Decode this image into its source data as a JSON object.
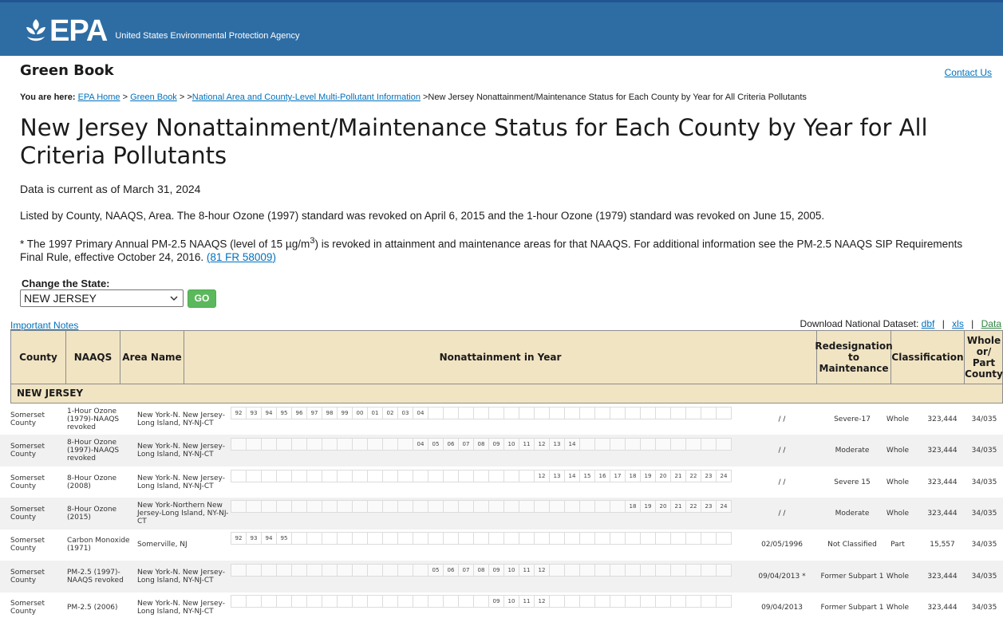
{
  "header": {
    "logo_text": "EPA",
    "agency_name": "United States Environmental Protection Agency"
  },
  "site_name": "Green Book",
  "contact_label": "Contact Us",
  "breadcrumb": {
    "prefix": "You are here:",
    "items": [
      "EPA Home",
      "Green Book",
      "National Area and County-Level Multi-Pollutant Information"
    ],
    "current": "New Jersey Nonattainment/Maintenance Status for Each County by Year for All Criteria Pollutants",
    "sep1": " > ",
    "sep2": " > >",
    "sep3": " >"
  },
  "page_title": "New Jersey Nonattainment/Maintenance Status for Each County by Year for All Criteria Pollutants",
  "as_of": "Data is current as of March 31, 2024",
  "listed_text": "Listed by County, NAAQS, Area. The 8-hour Ozone (1997) standard was revoked on April 6, 2015 and the 1-hour Ozone (1979) standard was revoked on June 15, 2005.",
  "note": {
    "text_a": "* The 1997 Primary Annual PM-2.5 NAAQS (level of 15 µg/m",
    "sup": "3",
    "text_b": ") is revoked in attainment and maintenance areas for that NAAQS. For additional information see the PM-2.5 NAAQS SIP Requirements Final Rule, effective October 24, 2016. ",
    "link": "(81 FR 58009)"
  },
  "state_selector": {
    "label": "Change the State:",
    "selected": "NEW JERSEY",
    "go_label": "GO"
  },
  "important_notes": "Important Notes",
  "download": {
    "label": "Download National Dataset:",
    "dbf": "dbf",
    "xls": "xls",
    "data": "Data",
    "sep": "|"
  },
  "table": {
    "headers": {
      "county": "County",
      "naaqs": "NAAQS",
      "area": "Area Name",
      "years": "Nonattainment in Year",
      "redesignation": "Redesignation to Maintenance",
      "classification": "Classification",
      "whole_part": "Whole or/ Part County"
    },
    "state_row": "NEW JERSEY",
    "rows": [
      {
        "county": "Somerset County",
        "naaqs": "1-Hour Ozone (1979)-NAAQS revoked",
        "area": "New York-N. New Jersey-Long Island, NY-NJ-CT",
        "years": [
          "92",
          "93",
          "94",
          "95",
          "96",
          "97",
          "98",
          "99",
          "00",
          "01",
          "02",
          "03",
          "04",
          "",
          "",
          "",
          "",
          "",
          "",
          "",
          "",
          "",
          "",
          "",
          "",
          "",
          "",
          "",
          "",
          "",
          "",
          "",
          ""
        ],
        "redesignation": "/ /",
        "classification": "Severe-17",
        "whole_part": "Whole",
        "population": "323,444",
        "fips": "34/035"
      },
      {
        "county": "Somerset County",
        "naaqs": "8-Hour Ozone (1997)-NAAQS revoked",
        "area": "New York-N. New Jersey-Long Island, NY-NJ-CT",
        "years": [
          "",
          "",
          "",
          "",
          "",
          "",
          "",
          "",
          "",
          "",
          "",
          "",
          "04",
          "05",
          "06",
          "07",
          "08",
          "09",
          "10",
          "11",
          "12",
          "13",
          "14",
          "",
          "",
          "",
          "",
          "",
          "",
          "",
          "",
          "",
          ""
        ],
        "redesignation": "/ /",
        "classification": "Moderate",
        "whole_part": "Whole",
        "population": "323,444",
        "fips": "34/035"
      },
      {
        "county": "Somerset County",
        "naaqs": "8-Hour Ozone (2008)",
        "area": "New York-N. New Jersey-Long Island, NY-NJ-CT",
        "years": [
          "",
          "",
          "",
          "",
          "",
          "",
          "",
          "",
          "",
          "",
          "",
          "",
          "",
          "",
          "",
          "",
          "",
          "",
          "",
          "",
          "12",
          "13",
          "14",
          "15",
          "16",
          "17",
          "18",
          "19",
          "20",
          "21",
          "22",
          "23",
          "24"
        ],
        "redesignation": "/ /",
        "classification": "Severe 15",
        "whole_part": "Whole",
        "population": "323,444",
        "fips": "34/035"
      },
      {
        "county": "Somerset County",
        "naaqs": "8-Hour Ozone (2015)",
        "area": "New York-Northern New Jersey-Long Island, NY-NJ-CT",
        "years": [
          "",
          "",
          "",
          "",
          "",
          "",
          "",
          "",
          "",
          "",
          "",
          "",
          "",
          "",
          "",
          "",
          "",
          "",
          "",
          "",
          "",
          "",
          "",
          "",
          "",
          "",
          "18",
          "19",
          "20",
          "21",
          "22",
          "23",
          "24"
        ],
        "redesignation": "/ /",
        "classification": "Moderate",
        "whole_part": "Whole",
        "population": "323,444",
        "fips": "34/035"
      },
      {
        "county": "Somerset County",
        "naaqs": "Carbon Monoxide (1971)",
        "area": "Somerville, NJ",
        "years": [
          "92",
          "93",
          "94",
          "95",
          "",
          "",
          "",
          "",
          "",
          "",
          "",
          "",
          "",
          "",
          "",
          "",
          "",
          "",
          "",
          "",
          "",
          "",
          "",
          "",
          "",
          "",
          "",
          "",
          "",
          "",
          "",
          "",
          ""
        ],
        "redesignation": "02/05/1996",
        "classification": "Not Classified",
        "whole_part": "Part",
        "population": "15,557",
        "fips": "34/035"
      },
      {
        "county": "Somerset County",
        "naaqs": "PM-2.5 (1997)-NAAQS revoked",
        "area": "New York-N. New Jersey-Long Island, NY-NJ-CT",
        "years": [
          "",
          "",
          "",
          "",
          "",
          "",
          "",
          "",
          "",
          "",
          "",
          "",
          "",
          "05",
          "06",
          "07",
          "08",
          "09",
          "10",
          "11",
          "12",
          "",
          "",
          "",
          "",
          "",
          "",
          "",
          "",
          "",
          "",
          "",
          ""
        ],
        "redesignation": "09/04/2013 *",
        "classification": "Former Subpart 1",
        "whole_part": "Whole",
        "population": "323,444",
        "fips": "34/035"
      },
      {
        "county": "Somerset County",
        "naaqs": "PM-2.5 (2006)",
        "area": "New York-N. New Jersey-Long Island, NY-NJ-CT",
        "years": [
          "",
          "",
          "",
          "",
          "",
          "",
          "",
          "",
          "",
          "",
          "",
          "",
          "",
          "",
          "",
          "",
          "",
          "09",
          "10",
          "11",
          "12",
          "",
          "",
          "",
          "",
          "",
          "",
          "",
          "",
          "",
          "",
          "",
          ""
        ],
        "redesignation": "09/04/2013",
        "classification": "Former Subpart 1",
        "whole_part": "Whole",
        "population": "323,444",
        "fips": "34/035"
      }
    ]
  }
}
